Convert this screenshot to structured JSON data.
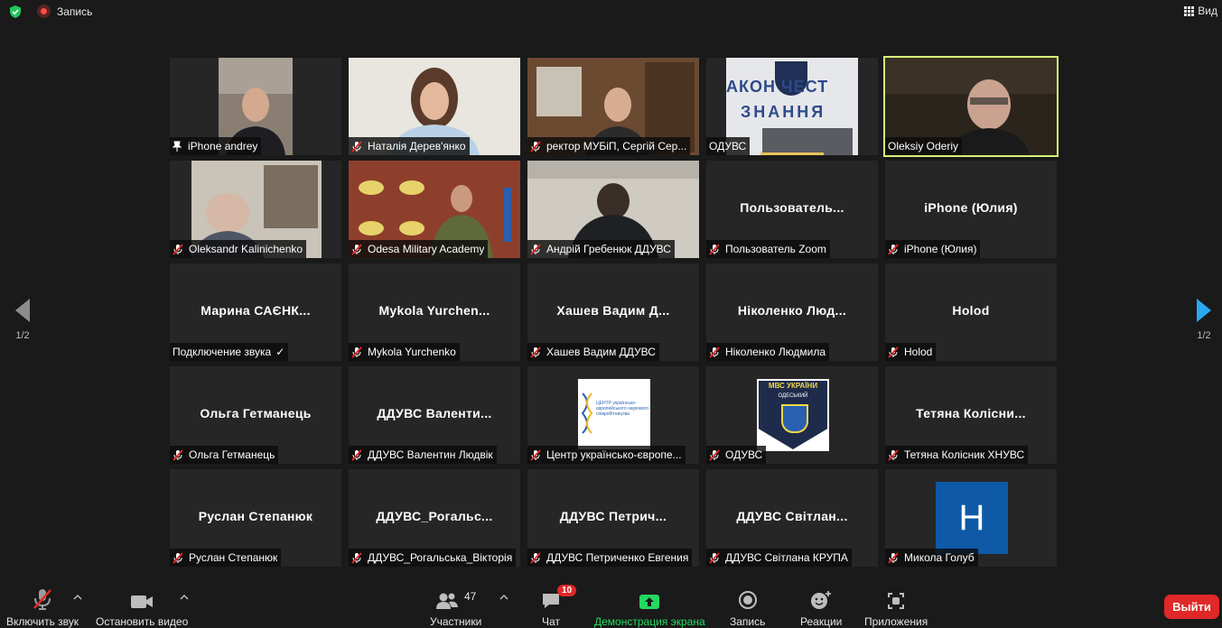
{
  "topbar": {
    "record_label": "Запись",
    "view_label": "Вид"
  },
  "tiles": [
    {
      "name": "",
      "label": "iPhone andrey",
      "pin": true,
      "mute": false
    },
    {
      "name": "",
      "label": "Наталія Дерев'янко",
      "mute": true
    },
    {
      "name": "",
      "label": "ректор МУБіП, Сергій Сер...",
      "mute": true
    },
    {
      "name": "",
      "label": "ОДУВС",
      "mute": false
    },
    {
      "name": "",
      "label": "Oleksiy Oderiy",
      "mute": false
    },
    {
      "name": "",
      "label": "Oleksandr Kalinichenko",
      "mute": true
    },
    {
      "name": "",
      "label": "Odesa Military Academy",
      "mute": true
    },
    {
      "name": "",
      "label": "Андрій Гребенюк ДДУВС",
      "mute": true
    },
    {
      "name": "Пользователь...",
      "label": "Пользователь Zoom",
      "mute": true
    },
    {
      "name": "iPhone (Юлия)",
      "label": "iPhone (Юлия)",
      "mute": true
    },
    {
      "name": "Марина САЄНК...",
      "label": "Подключение звука",
      "mute": false,
      "check": "✓"
    },
    {
      "name": "Mykola Yurchen...",
      "label": "Mykola Yurchenko",
      "mute": true
    },
    {
      "name": "Хашев Вадим Д...",
      "label": "Хашев Вадим ДДУВС",
      "mute": true
    },
    {
      "name": "Ніколенко Люд...",
      "label": "Ніколенко Людмила",
      "mute": true
    },
    {
      "name": "Holod",
      "label": "Holod",
      "mute": true
    },
    {
      "name": "Ольга Гетманець",
      "label": "Ольга Гетманець",
      "mute": true
    },
    {
      "name": "ДДУВС Валенти...",
      "label": "ДДУВС Валентин Людвік",
      "mute": true
    },
    {
      "name": "",
      "label": "Центр українсько-європе...",
      "mute": true
    },
    {
      "name": "",
      "label": "ОДУВС",
      "mute": true
    },
    {
      "name": "Тетяна Колісни...",
      "label": "Тетяна Колісник ХНУВС",
      "mute": true
    },
    {
      "name": "Руслан Степанюк",
      "label": "Руслан Степанюк",
      "mute": true
    },
    {
      "name": "ДДУВС_Рогальс...",
      "label": "ДДУВС_Рогальська_Вікторія",
      "mute": true
    },
    {
      "name": "ДДУВС Петрич...",
      "label": "ДДУВС Петриченко Евгения",
      "mute": true
    },
    {
      "name": "ДДУВС Світлан...",
      "label": "ДДУВС Світлана КРУПА",
      "mute": true
    },
    {
      "name": "",
      "label": "Микола Голуб",
      "mute": true
    }
  ],
  "screen_text": {
    "banner_line1": "АКОН ЧЕСТ",
    "banner_line2": "ЗНАННЯ",
    "center_logo": "ЦЕНТР українсько-європейського наукового співробітництва",
    "police_badge_top": "МВС УКРАЇНИ",
    "police_badge_mid": "ОДЕСЬКИЙ",
    "avatar_letter": "H"
  },
  "pagination": {
    "left": "1/2",
    "right": "1/2"
  },
  "toolbar": {
    "unmute": "Включить звук",
    "video": "Остановить видео",
    "participants": "Участники",
    "participants_count": "47",
    "chat": "Чат",
    "chat_badge": "10",
    "share": "Демонстрация экрана",
    "record": "Запись",
    "reactions": "Реакции",
    "apps": "Приложения",
    "leave": "Выйти"
  },
  "colors": {
    "accent_green": "#23d962",
    "active_border": "#d7f07a",
    "leave_red": "#e02828",
    "nav_blue": "#2aa8f2",
    "avatar_blue": "#0e5aa7"
  }
}
